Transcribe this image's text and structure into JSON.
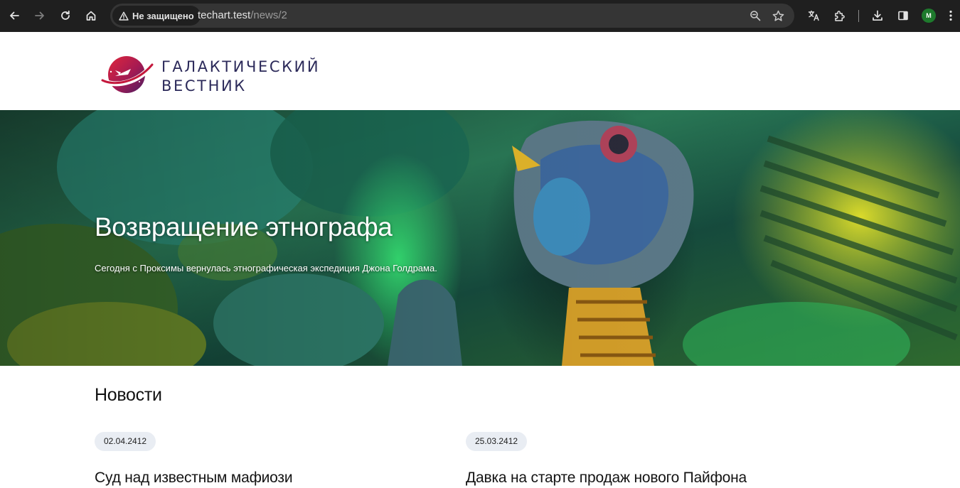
{
  "browser": {
    "security_label": "Не защищено",
    "url_host": "techart.test",
    "url_path": "/news/2",
    "profile_initial": "M",
    "icons": [
      "back-icon",
      "forward-icon",
      "reload-icon",
      "home-icon",
      "warning-icon",
      "zoom-icon",
      "star-icon",
      "translate-icon",
      "extensions-icon",
      "download-icon",
      "side-panel-icon",
      "menu-icon"
    ]
  },
  "site": {
    "logo_line1": "ГАЛАКТИЧЕСКИЙ",
    "logo_line2": "ВЕСТНИК"
  },
  "hero": {
    "title": "Возвращение этнографа",
    "subtitle": "Сегодня с Проксимы вернулась этнографическая экспедиция Джона Голдрама."
  },
  "news": {
    "heading": "Новости",
    "items": [
      {
        "date": "02.04.2412",
        "title": "Суд над известным мафиози"
      },
      {
        "date": "25.03.2412",
        "title": "Давка на старте продаж нового Пайфона"
      }
    ]
  },
  "colors": {
    "chrome_bg": "#1f1f1f",
    "omnibox_bg": "#353535",
    "logo_text": "#2c2a5a",
    "logo_accent": "#c4183c",
    "date_badge_bg": "#e9edf3"
  }
}
